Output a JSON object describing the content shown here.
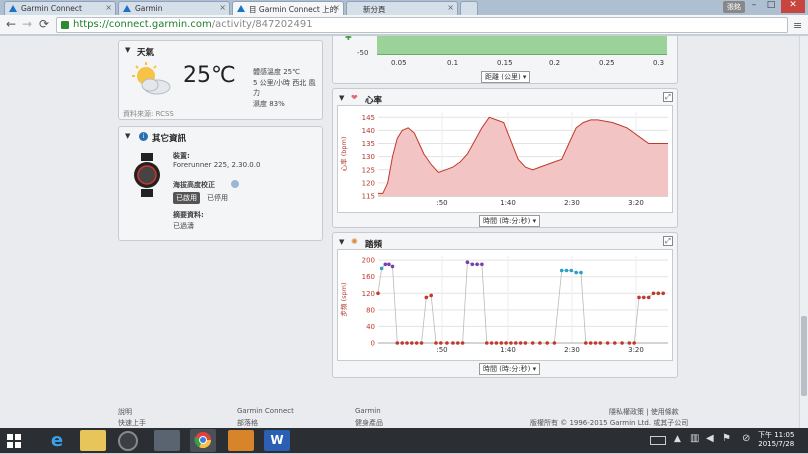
{
  "browser": {
    "tabs": [
      {
        "label": "Garmin Connect",
        "active": false
      },
      {
        "label": "Garmin",
        "active": false
      },
      {
        "label": "目 Garmin Connect 上的",
        "active": true
      },
      {
        "label": "新分頁",
        "active": false
      }
    ],
    "user_badge": "張銘",
    "url_scheme": "https://",
    "url_host": "connect.garmin.com",
    "url_path": "/activity/847202491"
  },
  "weather": {
    "title": "天氣",
    "temperature": "25℃",
    "line1": "體感溫度 25℃",
    "line2": "5 公里/小時 西北 風",
    "line3": "力",
    "line4": "濕度 83%",
    "source": "資料來源: RCSS"
  },
  "info": {
    "title": "其它資訊",
    "device_label": "裝置:",
    "device_value": "Forerunner 225, 2.30.0.0",
    "altitude_label": "海拔高度校正",
    "enabled": "已啟用",
    "disabled": "已停用",
    "summary_label": "摘要資料:",
    "summary_value": "已過濤"
  },
  "top_chart": {
    "x_ticks": [
      "0.05",
      "0.1",
      "0.15",
      "0.2",
      "0.25",
      "0.3"
    ],
    "y_tick": "-50",
    "axis_select": "距離 (公里)"
  },
  "heart_chart": {
    "title": "心率",
    "ylabel": "心率 (bpm)",
    "axis_select": "時間 (時:分:秒)"
  },
  "cadence_chart": {
    "title": "踏頻",
    "ylabel": "步頻 (spm)",
    "axis_select": "時間 (時:分:秒)"
  },
  "chart_data": [
    {
      "type": "area",
      "title": "心率",
      "ylabel": "心率 (bpm)",
      "xlabel": "時間 (時:分:秒)",
      "x_ticks": [
        ":50",
        "1:40",
        "2:30",
        "3:20"
      ],
      "y_ticks": [
        115,
        120,
        125,
        130,
        135,
        140,
        145
      ],
      "ylim": [
        115,
        147
      ],
      "xlim": [
        0,
        240
      ],
      "x": [
        0,
        4,
        8,
        12,
        16,
        20,
        25,
        30,
        34,
        38,
        44,
        50,
        56,
        62,
        68,
        74,
        80,
        86,
        92,
        98,
        104,
        110,
        116,
        122,
        128,
        134,
        140,
        146,
        152,
        158,
        164,
        170,
        176,
        182,
        188,
        194,
        200,
        206,
        212,
        218,
        224,
        230,
        236,
        240
      ],
      "values": [
        116,
        116,
        120,
        130,
        137,
        140,
        141,
        139,
        135,
        131,
        127,
        124,
        125,
        126,
        128,
        131,
        136,
        141,
        145,
        144,
        143,
        136,
        129,
        126,
        125,
        126,
        127,
        128,
        129,
        135,
        141,
        143,
        144,
        144,
        143.5,
        143,
        142,
        141,
        139,
        137,
        135,
        135,
        135,
        135
      ],
      "color": "#c0392b",
      "fill": "#f3c4c4"
    },
    {
      "type": "scatter",
      "title": "踏頻",
      "ylabel": "步頻 (spm)",
      "xlabel": "時間 (時:分:秒)",
      "x_ticks": [
        ":50",
        "1:40",
        "2:30",
        "3:20"
      ],
      "y_ticks": [
        0,
        40,
        80,
        120,
        160,
        200
      ],
      "ylim": [
        0,
        210
      ],
      "xlim": [
        0,
        240
      ],
      "x": [
        0,
        3,
        6,
        9,
        12,
        16,
        20,
        24,
        28,
        32,
        36,
        40,
        44,
        48,
        52,
        57,
        62,
        66,
        70,
        74,
        78,
        82,
        86,
        90,
        94,
        98,
        102,
        106,
        110,
        114,
        118,
        122,
        128,
        134,
        140,
        146,
        152,
        156,
        160,
        164,
        168,
        172,
        176,
        180,
        184,
        190,
        196,
        202,
        208,
        212,
        216,
        220,
        224,
        228,
        232,
        236
      ],
      "values": [
        120,
        180,
        190,
        190,
        185,
        0,
        0,
        0,
        0,
        0,
        0,
        110,
        115,
        0,
        0,
        0,
        0,
        0,
        0,
        195,
        190,
        190,
        190,
        0,
        0,
        0,
        0,
        0,
        0,
        0,
        0,
        0,
        0,
        0,
        0,
        0,
        175,
        175,
        175,
        170,
        170,
        0,
        0,
        0,
        0,
        0,
        0,
        0,
        0,
        0,
        110,
        110,
        110,
        120,
        120,
        120
      ]
    }
  ],
  "footer": {
    "col1_a": "說明",
    "col1_b": "快速上手",
    "col2_a": "Garmin Connect",
    "col2_b": "部落格",
    "col3_a": "Garmin",
    "col3_b": "健身產品",
    "right_a": "隱私權政策 | 使用條款",
    "right_b": "版權所有 © 1996-2015 Garmin Ltd. 或其子公司"
  },
  "taskbar": {
    "time": "下午 11:05",
    "date": "2015/7/28"
  }
}
